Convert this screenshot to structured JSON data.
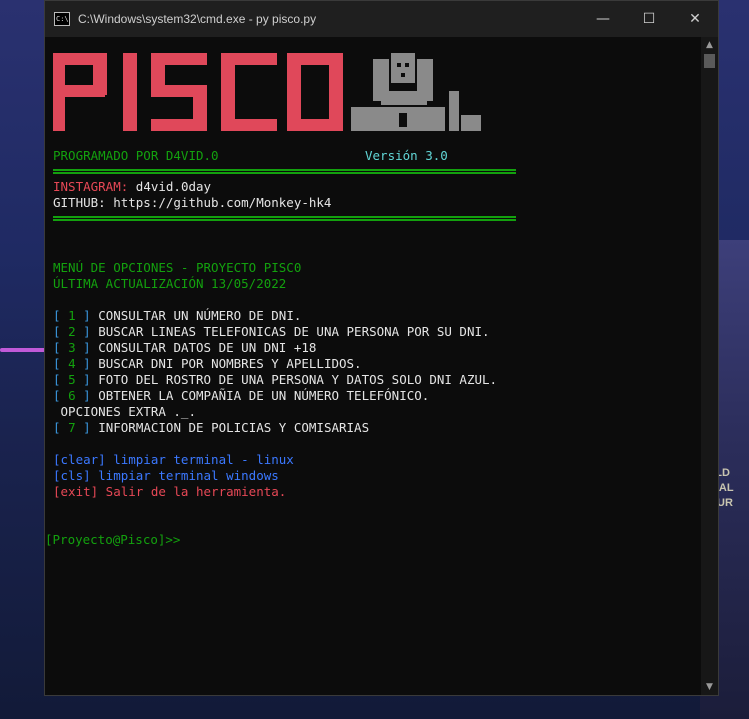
{
  "window": {
    "title": "C:\\Windows\\system32\\cmd.exe - py  pisco.py",
    "minimize": "—",
    "maximize": "☐",
    "close": "✕"
  },
  "desktop": {
    "sign_lines": [
      "GOLD",
      "MEDAL",
      "FLOUR"
    ]
  },
  "banner": {
    "logo_text": "PISCO",
    "logo_color": "#e0485a",
    "author": "PROGRAMADO POR D4VID.0",
    "version": "Versión 3.0",
    "instagram_label": "INSTAGRAM: ",
    "instagram_value": "d4vid.0day",
    "github": "GITHUB: https://github.com/Monkey-hk4"
  },
  "menu": {
    "title": "MENÚ DE OPCIONES - PROYECTO PISC0",
    "updated": "ÚLTIMA ACTUALIZACIÓN 13/05/2022",
    "options": [
      {
        "num": "1",
        "label": "CONSULTAR UN NÚMERO DE DNI."
      },
      {
        "num": "2",
        "label": "BUSCAR LINEAS TELEFONICAS DE UNA PERSONA POR SU DNI."
      },
      {
        "num": "3",
        "label": "CONSULTAR DATOS DE UN DNI +18"
      },
      {
        "num": "4",
        "label": "BUSCAR DNI POR NOMBRES Y APELLIDOS."
      },
      {
        "num": "5",
        "label": "FOTO DEL ROSTRO DE UNA PERSONA Y DATOS SOLO DNI AZUL."
      },
      {
        "num": "6",
        "label": "OBTENER LA COMPAÑIA DE UN NÚMERO TELEFÓNICO."
      }
    ],
    "extra_title": " OPCIONES EXTRA ._.",
    "extra_option": {
      "num": "7",
      "label": "INFORMACION DE POLICIAS Y COMISARIAS"
    },
    "clear_linux": "[clear] limpiar terminal - linux",
    "clear_windows": "[cls] limpiar terminal windows",
    "exit": "[exit] Salir de la herramienta."
  },
  "prompt": "[Proyecto@Pisco]>>"
}
